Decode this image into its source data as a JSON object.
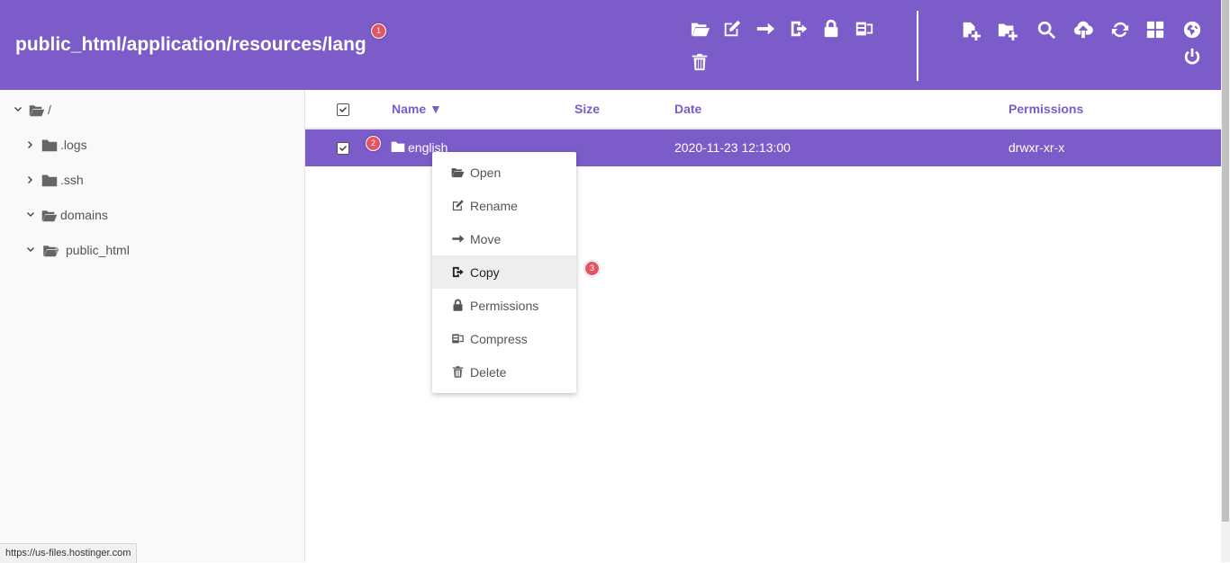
{
  "header": {
    "path": "public_html/application/resources/lang",
    "badge": "1",
    "toolbar_icons": [
      "open-folder-icon",
      "rename-icon",
      "move-icon",
      "copy-icon",
      "lock-icon",
      "compress-icon",
      "trash-icon",
      "new-file-icon",
      "new-folder-icon",
      "search-icon",
      "upload-icon",
      "refresh-icon",
      "grid-view-icon",
      "globe-icon",
      "power-icon"
    ]
  },
  "sidebar": {
    "items": [
      {
        "label": "/",
        "icon": "folder-open-icon",
        "expanded": true
      },
      {
        "label": ".logs",
        "icon": "folder-icon",
        "expanded": false
      },
      {
        "label": ".ssh",
        "icon": "folder-icon",
        "expanded": false
      },
      {
        "label": "domains",
        "icon": "folder-open-icon",
        "expanded": true
      },
      {
        "label": "public_html",
        "icon": "folder-link-icon",
        "expanded": true
      }
    ]
  },
  "table": {
    "columns": {
      "name": "Name ▼",
      "size": "Size",
      "date": "Date",
      "permissions": "Permissions"
    },
    "rows": [
      {
        "name": "english",
        "size": "",
        "date": "2020-11-23 12:13:00",
        "permissions": "drwxr-xr-x",
        "badge": "2",
        "selected": true
      }
    ]
  },
  "context_menu": {
    "items": [
      {
        "label": "Open",
        "icon": "folder-open-icon"
      },
      {
        "label": "Rename",
        "icon": "rename-icon"
      },
      {
        "label": "Move",
        "icon": "arrow-right-icon"
      },
      {
        "label": "Copy",
        "icon": "copy-icon"
      },
      {
        "label": "Permissions",
        "icon": "lock-icon"
      },
      {
        "label": "Compress",
        "icon": "compress-icon"
      },
      {
        "label": "Delete",
        "icon": "trash-icon"
      }
    ],
    "active_item": "Copy",
    "badge": "3"
  },
  "status": {
    "url": "https://us-files.hostinger.com"
  },
  "colors": {
    "accent": "#7b5cc8",
    "badge": "#e25563"
  }
}
